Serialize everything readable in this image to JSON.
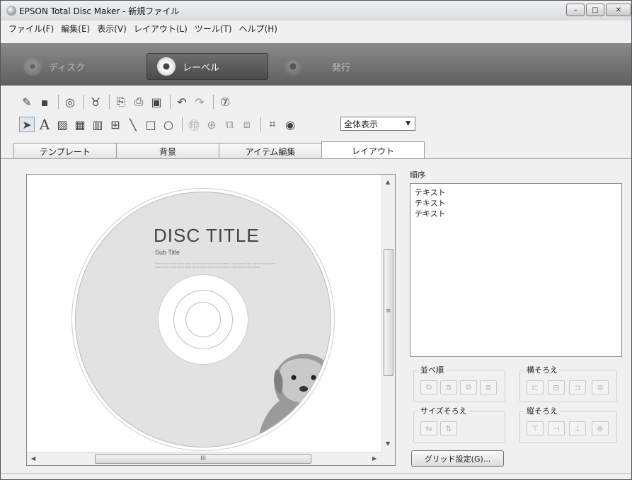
{
  "window": {
    "title": "EPSON Total Disc Maker - 新規ファイル",
    "controls": [
      "–",
      "□",
      "✕"
    ]
  },
  "menu": [
    "ファイル(F)",
    "編集(E)",
    "表示(V)",
    "レイアウト(L)",
    "ツール(T)",
    "ヘルプ(H)"
  ],
  "modes": {
    "disc": "ディスク",
    "label": "レーベル",
    "print": "発行"
  },
  "zoom": {
    "selected": "全体表示"
  },
  "tabs": [
    "テンプレート",
    "背景",
    "アイテム編集",
    "レイアウト"
  ],
  "canvas": {
    "disc_title": "DISC TITLE",
    "sub_title": "Sub Title",
    "data_text": "Data Name Data Name Data Name Data Name Data Name Data Name Data Name Data Name Data Name Data Name Data Name Data Name Data Name Data Name Data Name",
    "hscroll_grip": "III",
    "vscroll_grip": "≡"
  },
  "panel": {
    "order_label": "順序",
    "order_items": [
      "テキスト",
      "テキスト",
      "テキスト"
    ],
    "arrange_label": "並べ順",
    "halign_label": "横そろえ",
    "size_label": "サイズそろえ",
    "valign_label": "縦そろえ",
    "grid_button": "グリッド設定(G)..."
  }
}
